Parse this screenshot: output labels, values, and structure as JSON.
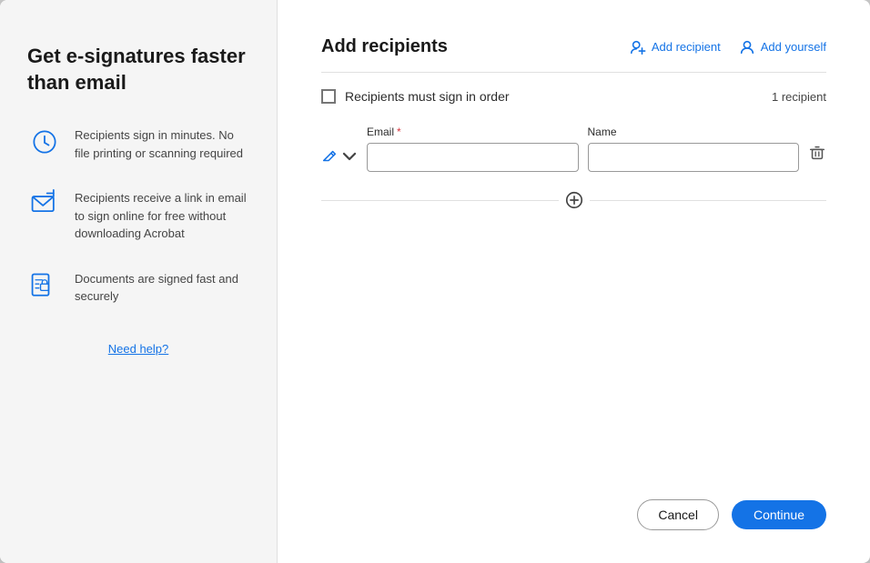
{
  "left": {
    "title": "Get e-signatures faster than email",
    "features": [
      {
        "id": "minutes",
        "text": "Recipients sign in minutes. No file printing or scanning required"
      },
      {
        "id": "email-link",
        "text": "Recipients receive a link in email to sign online for free without downloading Acrobat"
      },
      {
        "id": "secure",
        "text": "Documents are signed fast and securely"
      }
    ],
    "need_help": "Need help?"
  },
  "right": {
    "title": "Add recipients",
    "add_recipient_label": "Add recipient",
    "add_yourself_label": "Add yourself",
    "order_label": "Recipients must sign in order",
    "recipient_count": "1 recipient",
    "email_label": "Email",
    "name_label": "Name",
    "email_placeholder": "",
    "name_placeholder": ""
  },
  "footer": {
    "cancel_label": "Cancel",
    "continue_label": "Continue"
  }
}
